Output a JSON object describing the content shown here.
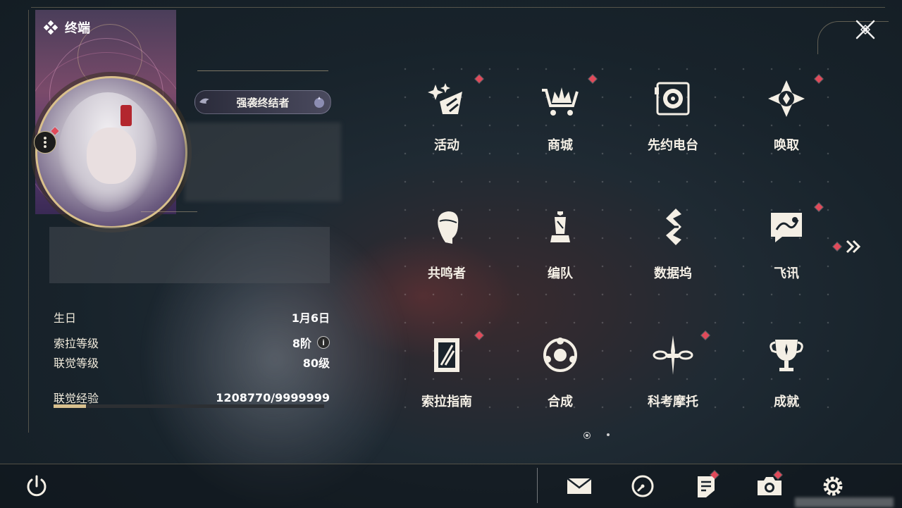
{
  "window": {
    "title": "终端"
  },
  "profile": {
    "title_badge": "强袭终结者",
    "stats": [
      {
        "label": "生日",
        "value": "1月6日"
      },
      {
        "label": "索拉等级",
        "value": "8阶",
        "has_info": true
      },
      {
        "label": "联觉等级",
        "value": "80级"
      }
    ],
    "experience": {
      "label": "联觉经验",
      "value": "1208770/9999999",
      "progress": 0.12
    }
  },
  "menu": [
    {
      "label": "活动",
      "icon": "activity-icon",
      "badge": true
    },
    {
      "label": "商城",
      "icon": "shop-cart-icon",
      "badge": true
    },
    {
      "label": "先约电台",
      "icon": "radio-icon",
      "badge": false
    },
    {
      "label": "唤取",
      "icon": "summon-compass-icon",
      "badge": true
    },
    {
      "label": "共鸣者",
      "icon": "resonator-head-icon",
      "badge": false
    },
    {
      "label": "编队",
      "icon": "team-chess-icon",
      "badge": false
    },
    {
      "label": "数据坞",
      "icon": "data-dock-icon",
      "badge": false
    },
    {
      "label": "飞讯",
      "icon": "message-icon",
      "badge": true
    },
    {
      "label": "索拉指南",
      "icon": "guide-book-icon",
      "badge": true
    },
    {
      "label": "合成",
      "icon": "synthesis-icon",
      "badge": false
    },
    {
      "label": "科考摩托",
      "icon": "motorcycle-icon",
      "badge": true
    },
    {
      "label": "成就",
      "icon": "trophy-icon",
      "badge": false
    }
  ],
  "pager": {
    "current": 1,
    "total": 2
  },
  "bottom_bar": [
    {
      "name": "mail-icon",
      "badge": false
    },
    {
      "name": "clock-icon",
      "badge": false
    },
    {
      "name": "notice-icon",
      "badge": true
    },
    {
      "name": "camera-icon",
      "badge": true
    },
    {
      "name": "settings-gear-icon",
      "badge": false
    }
  ],
  "colors": {
    "accent": "#d8c08e",
    "badge_red": "#e04a5a",
    "text": "#f4efe5"
  }
}
